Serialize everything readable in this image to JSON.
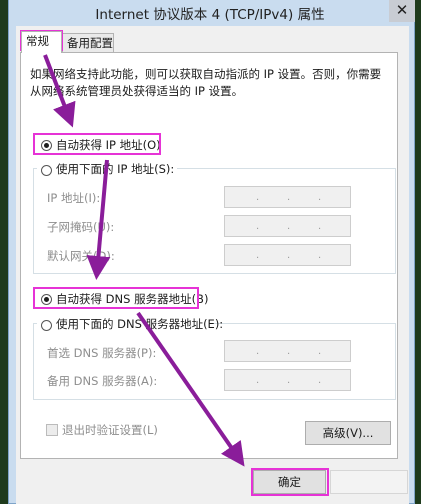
{
  "window": {
    "title": "Internet 协议版本 4 (TCP/IPv4) 属性",
    "close_glyph": "✕"
  },
  "tabs": [
    {
      "label": "常规",
      "active": true
    },
    {
      "label": "备用配置",
      "active": false
    }
  ],
  "description": "如果网络支持此功能，则可以获取自动指派的 IP 设置。否则，你需要从网络系统管理员处获得适当的 IP 设置。",
  "ip_section": {
    "auto_label": "自动获得 IP 地址(O)",
    "auto_selected": true,
    "manual_label": "使用下面的 IP 地址(S):",
    "manual_selected": false,
    "fields": [
      {
        "label": "IP 地址(I):"
      },
      {
        "label": "子网掩码(U):"
      },
      {
        "label": "默认网关(D):"
      }
    ]
  },
  "dns_section": {
    "auto_label": "自动获得 DNS 服务器地址(B)",
    "auto_selected": true,
    "manual_label": "使用下面的 DNS 服务器地址(E):",
    "manual_selected": false,
    "fields": [
      {
        "label": "首选 DNS 服务器(P):"
      },
      {
        "label": "备用 DNS 服务器(A):"
      }
    ]
  },
  "ip_dot": ".",
  "validate_label": "退出时验证设置(L)",
  "validate_checked": false,
  "advanced_label": "高级(V)...",
  "ok_label": "确定",
  "colors": {
    "highlight": "#e633d6",
    "arrow": "#8a1d9a",
    "accent": "#0078d7"
  }
}
